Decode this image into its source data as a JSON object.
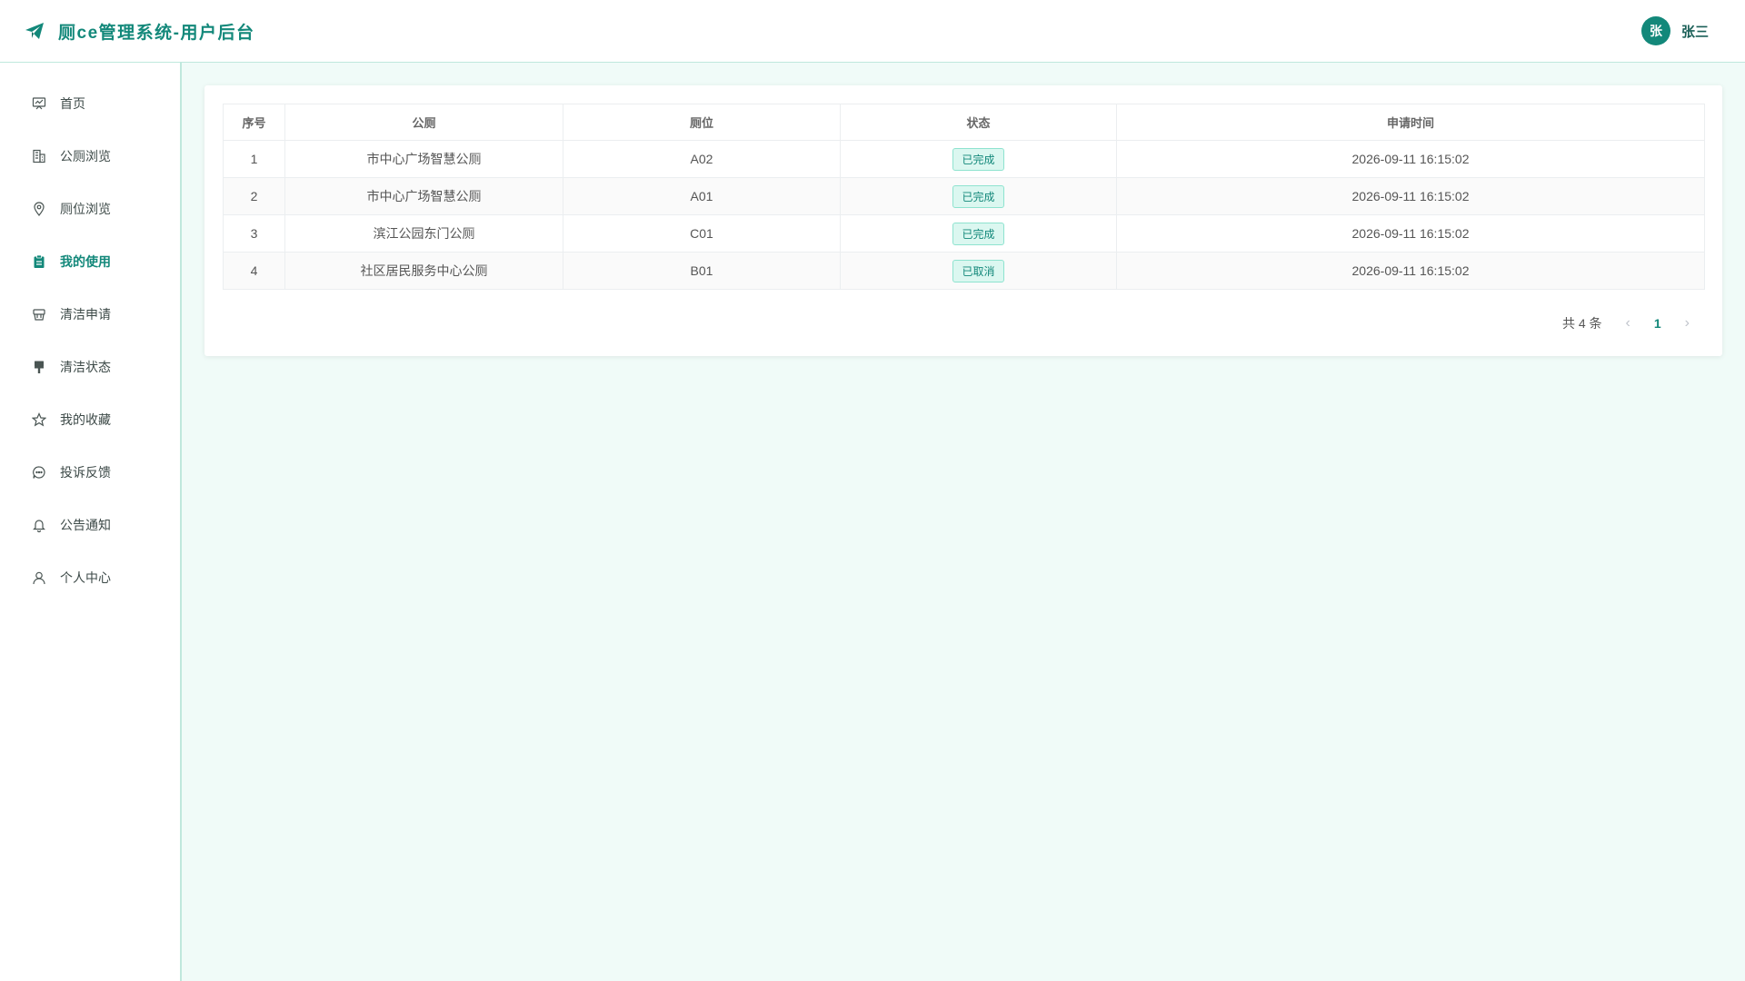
{
  "header": {
    "title": "厕ce管理系统-用户后台",
    "user": {
      "avatar_text": "张",
      "name": "张三"
    }
  },
  "sidebar": {
    "items": [
      {
        "label": "首页",
        "icon": "dashboard-icon",
        "active": false
      },
      {
        "label": "公厕浏览",
        "icon": "building-icon",
        "active": false
      },
      {
        "label": "厕位浏览",
        "icon": "location-pin-icon",
        "active": false
      },
      {
        "label": "我的使用",
        "icon": "clipboard-icon",
        "active": true
      },
      {
        "label": "清洁申请",
        "icon": "cleaning-icon",
        "active": false
      },
      {
        "label": "清洁状态",
        "icon": "brush-icon",
        "active": false
      },
      {
        "label": "我的收藏",
        "icon": "star-icon",
        "active": false
      },
      {
        "label": "投诉反馈",
        "icon": "chat-icon",
        "active": false
      },
      {
        "label": "公告通知",
        "icon": "bell-icon",
        "active": false
      },
      {
        "label": "个人中心",
        "icon": "user-icon",
        "active": false
      }
    ]
  },
  "table": {
    "columns": [
      "序号",
      "公厕",
      "厕位",
      "状态",
      "申请时间"
    ],
    "rows": [
      {
        "index": "1",
        "toilet": "市中心广场智慧公厕",
        "stall": "A02",
        "status": "已完成",
        "time": "2026-09-11 16:15:02"
      },
      {
        "index": "2",
        "toilet": "市中心广场智慧公厕",
        "stall": "A01",
        "status": "已完成",
        "time": "2026-09-11 16:15:02"
      },
      {
        "index": "3",
        "toilet": "滨江公园东门公厕",
        "stall": "C01",
        "status": "已完成",
        "time": "2026-09-11 16:15:02"
      },
      {
        "index": "4",
        "toilet": "社区居民服务中心公厕",
        "stall": "B01",
        "status": "已取消",
        "time": "2026-09-11 16:15:02"
      }
    ]
  },
  "pagination": {
    "total_text": "共 4 条",
    "current_page": "1",
    "prev": "‹",
    "next": "›"
  },
  "colors": {
    "accent": "#13887a",
    "background": "#f0fbf8",
    "tag_bg": "#dbf7f0"
  }
}
